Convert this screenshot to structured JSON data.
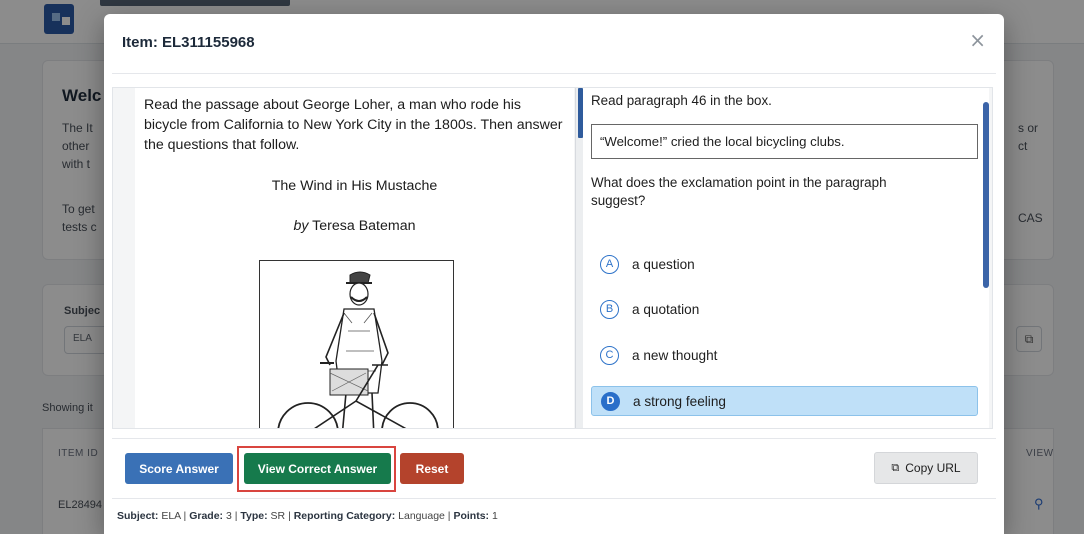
{
  "background": {
    "welcome_title": "Welc",
    "welcome_lines": [
      "The It",
      "other",
      "with t",
      "To get",
      "tests c"
    ],
    "welcome_right": [
      "s or",
      "ct",
      "CAS"
    ],
    "subject_label": "Subjec",
    "subject_value": "ELA",
    "showing_text": "Showing it",
    "col_item_id": "ITEM ID",
    "col_view": "VIEW",
    "row_item_id": "EL28494"
  },
  "modal": {
    "title": "Item: EL311155968",
    "close_symbol": "×"
  },
  "passage": {
    "intro": "Read the passage about George Loher, a man who rode his bicycle from California to New York City in the 1800s. Then answer the questions that follow.",
    "title": "The Wind in His Mustache",
    "author_prefix": "by",
    "author_name": "Teresa Bateman"
  },
  "question": {
    "prompt": "Read paragraph 46 in the box.",
    "quote": "“Welcome!” cried the local bicycling clubs.",
    "stem": "What does the exclamation point in the paragraph suggest?",
    "options": [
      {
        "letter": "A",
        "text": "a question"
      },
      {
        "letter": "B",
        "text": "a quotation"
      },
      {
        "letter": "C",
        "text": "a new thought"
      },
      {
        "letter": "D",
        "text": "a strong feeling"
      }
    ],
    "selected": "D"
  },
  "buttons": {
    "score": "Score Answer",
    "view_correct": "View Correct Answer",
    "reset": "Reset",
    "copy_url": "Copy URL"
  },
  "meta": {
    "subject_label": "Subject:",
    "subject_value": "ELA",
    "grade_label": "Grade:",
    "grade_value": "3",
    "type_label": "Type:",
    "type_value": "SR",
    "category_label": "Reporting Category:",
    "category_value": "Language",
    "points_label": "Points:",
    "points_value": "1",
    "separator": "|"
  },
  "colors": {
    "score_button": "#3a71b6",
    "correct_button": "#167a4c",
    "reset_button": "#b4432c",
    "selected_option": "#bfe0f8",
    "highlight_frame": "#d9453f"
  }
}
